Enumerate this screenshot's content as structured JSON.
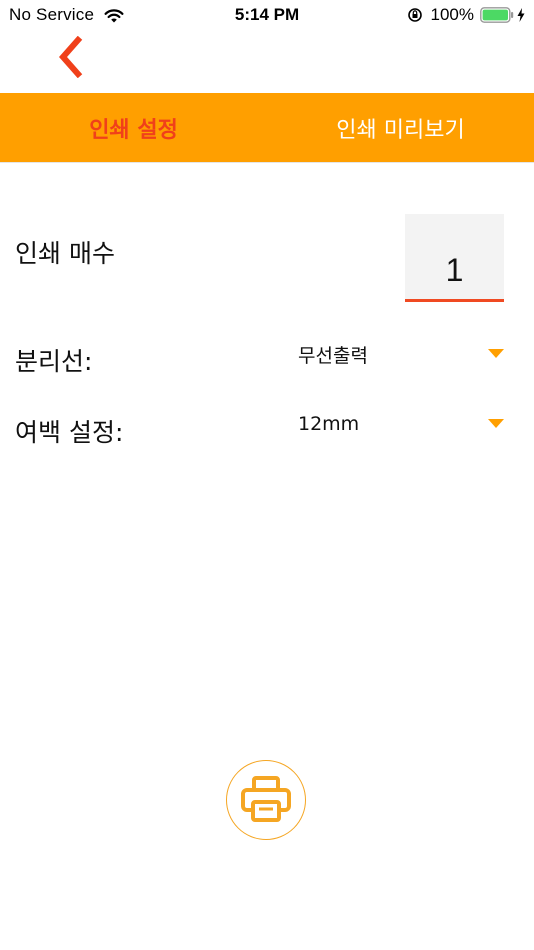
{
  "status_bar": {
    "carrier": "No Service",
    "time": "5:14 PM",
    "battery_percent": "100%",
    "battery_level": 1.0
  },
  "colors": {
    "tab_bar": "#ff9f00",
    "accent_red": "#f0401a",
    "print_orange": "#f5a623"
  },
  "nav": {
    "back_icon": "chevron-left-icon"
  },
  "tabs": [
    {
      "label": "인쇄 설정",
      "active": true
    },
    {
      "label": "인쇄 미리보기",
      "active": false
    }
  ],
  "settings": {
    "copies": {
      "label": "인쇄 매수",
      "value": "1"
    },
    "separator": {
      "label": "분리선:",
      "value": "무선출력"
    },
    "margin": {
      "label": "여백 설정:",
      "value": "12mm"
    }
  },
  "actions": {
    "print_icon": "printer-icon"
  }
}
